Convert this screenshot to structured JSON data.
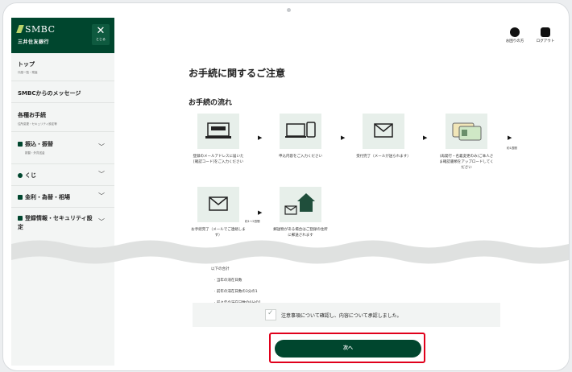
{
  "brand": {
    "logo_text": "SMBC",
    "bank_name": "三井住友銀行",
    "close_label": "とじる"
  },
  "header": {
    "help_label": "お困りの方",
    "logout_label": "ログアウト"
  },
  "sidebar": {
    "items": [
      {
        "label": "トップ",
        "sub": "口座一覧・残高"
      },
      {
        "label": "SMBCからのメッセージ",
        "sub": ""
      },
      {
        "label": "各種お手続",
        "sub": "住所変更・セキュリティ設定等"
      },
      {
        "label": "振込・振替",
        "sub": "振替・外貨送金"
      },
      {
        "label": "くじ",
        "sub": ""
      },
      {
        "label": "金利・為替・相場",
        "sub": ""
      },
      {
        "label": "登録情報・セキュリティ設定",
        "sub": ""
      }
    ]
  },
  "main": {
    "title": "お手続に関するご注意",
    "flow_title": "お手続の流れ",
    "steps": [
      {
        "caption": "登録のメールアドレスに届いた[確認コード]をご入力ください",
        "icon": "pc-code-icon"
      },
      {
        "caption": "申込内容をご入力ください",
        "icon": "devices-icon"
      },
      {
        "caption": "受付完了（メールが送られます）",
        "icon": "mail-icon"
      },
      {
        "caption": "(再発行・名義変更のみ)ご本人さま確認書類をアップロードしてください",
        "icon": "id-card-icon"
      },
      {
        "caption": "お手続完了（メールでご連絡します）",
        "icon": "mail-icon"
      },
      {
        "caption": "郵送物がある場合はご登録の住所に郵送されます",
        "icon": "house-mail-icon"
      }
    ],
    "durations": {
      "d1": "約1週間",
      "d2": "約1〜2週間"
    },
    "list": [
      "以下の合計",
      "当年の滞在日数",
      "前年の滞在日数の3分の1",
      "前々年の滞在日数の6分の1"
    ],
    "agree_text": "注意事項について確認し、内容について承認しました。",
    "next_label": "次へ"
  },
  "colors": {
    "brand_green": "#00462e",
    "highlight_red": "#e0001b",
    "icon_bg": "#e7efea"
  }
}
